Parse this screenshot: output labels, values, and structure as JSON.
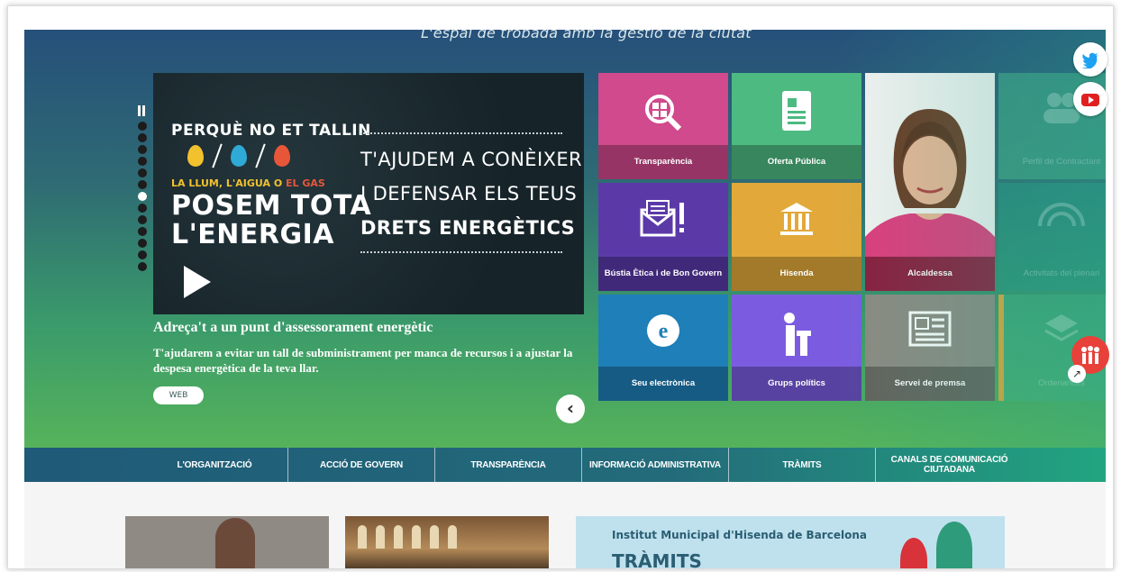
{
  "header": {
    "tagline": "L'espai de trobada amb la gestió de la ciutat"
  },
  "slider": {
    "slide_text": {
      "top": "PERQUÈ NO ET TALLIN",
      "sub_a": "LA LLUM, L'AIGUA O",
      "sub_b": "EL GAS",
      "big_1": "POSEM TOTA",
      "big_2": "L'ENERGIA",
      "right_1": "T'AJUDEM A CONÈIXER",
      "right_2": "I DEFENSAR ELS TEUS",
      "right_3": "DRETS ENERGÈTICS"
    },
    "title": "Adreça't a un punt d'assessorament energètic",
    "description": "T'ajudarem a evitar un tall de subministrament per manca de recursos i a ajustar la despesa energètica de la teva llar.",
    "web_button": "WEB",
    "prev_symbol": "‹"
  },
  "tiles": {
    "transparencia": "Transparència",
    "oferta_publica": "Oferta Pública",
    "alcaldessa": "Alcaldessa",
    "perfil": "Perfil de Contractant",
    "bustia": "Bústia Ètica i de Bon Govern",
    "hisenda": "Hisenda",
    "activitats": "Activitats del plenari",
    "seu": "Seu electrònica",
    "grups": "Grups polítics",
    "premsa": "Servei de premsa",
    "ordenances": "Ordenances"
  },
  "social": {
    "twitter": "twitter",
    "youtube": "youtube"
  },
  "menu": [
    "L'ORGANITZACIÓ",
    "ACCIÓ DE GOVERN",
    "TRANSPARÈNCIA",
    "INFORMACIÓ ADMINISTRATIVA",
    "TRÀMITS",
    "CANALS DE COMUNICACIÓ CIUTADANA"
  ],
  "lower": {
    "card3_title": "Institut Municipal d'Hisenda de Barcelona",
    "card3_sub": "TRÀMITS"
  },
  "colors": {
    "transparencia": "#d04a8d",
    "oferta": "#4dba82",
    "bustia": "#5b3aa8",
    "hisenda": "#e2a93a",
    "seu": "#1f7fb8",
    "grups": "#7b5ce0",
    "premsa": "#8d8a82",
    "alcaldessa": "#8b1e3f"
  }
}
